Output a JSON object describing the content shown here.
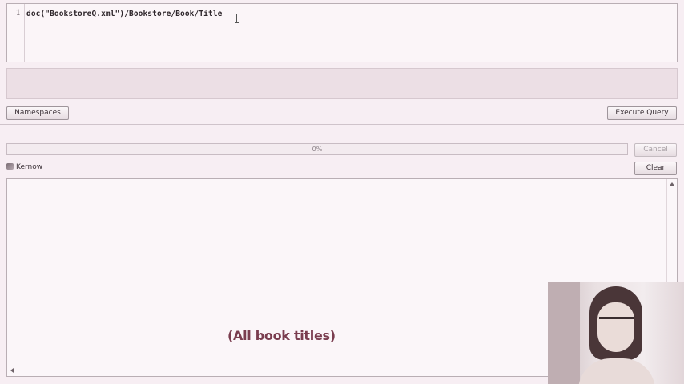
{
  "editor": {
    "line_number": "1",
    "query": "doc(\"BookstoreQ.xml\")/Bookstore/Book/Title"
  },
  "buttons": {
    "namespaces": "Namespaces",
    "execute_query": "Execute Query",
    "cancel": "Cancel",
    "clear": "Clear"
  },
  "progress": {
    "value": 0,
    "label": "0%"
  },
  "results_panel": {
    "title": "Kernow",
    "caption": "(All book titles)"
  },
  "icons": {
    "kernow": "kernow-app-icon",
    "scroll_up": "scroll-up-arrow-icon",
    "scroll_left": "scroll-left-arrow-icon",
    "cursor": "text-cursor-icon"
  },
  "colors": {
    "background": "#f7eef3",
    "caption": "#7a3d4f"
  }
}
